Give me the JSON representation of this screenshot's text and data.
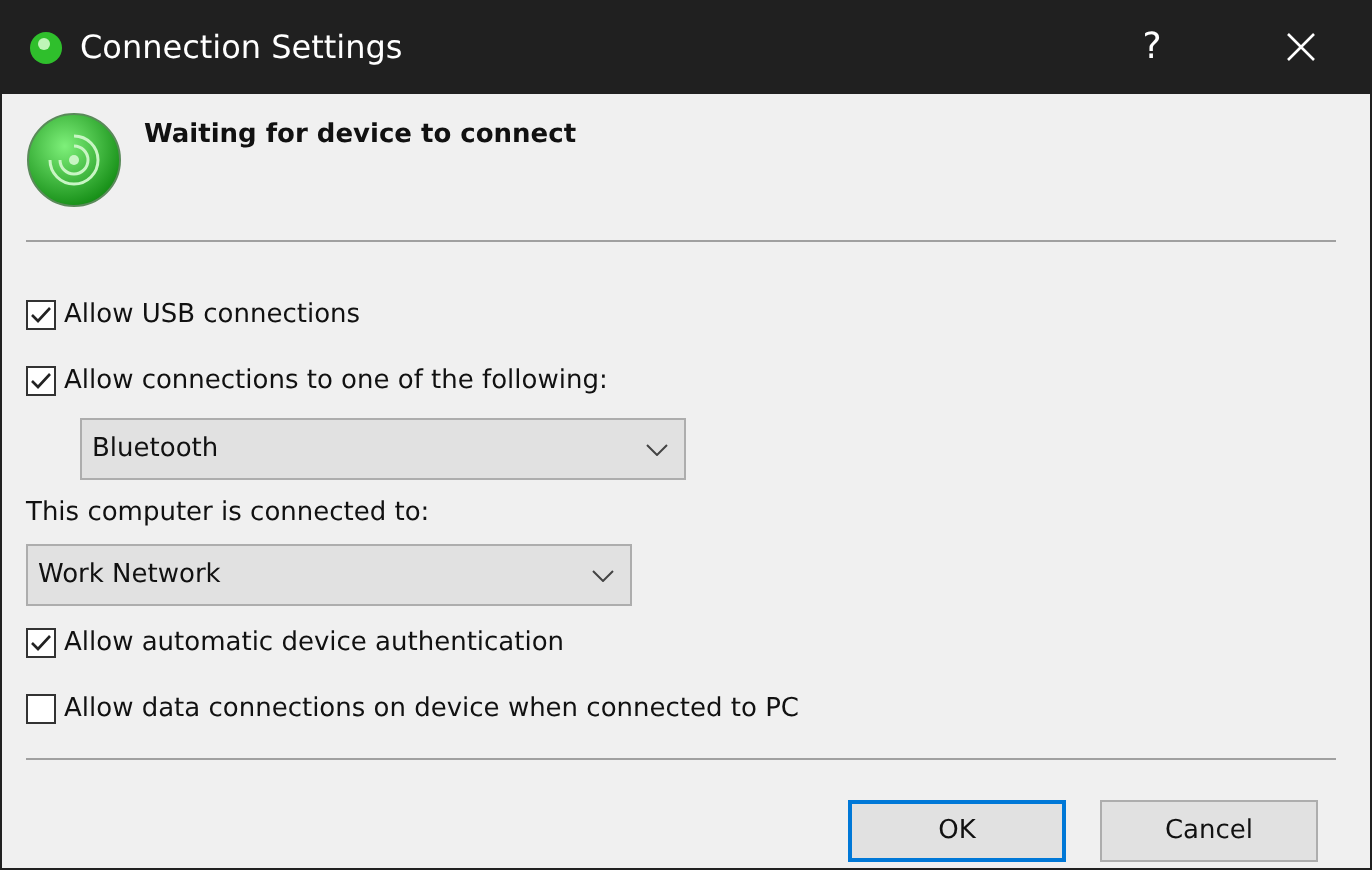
{
  "window": {
    "title": "Connection Settings",
    "help": "?"
  },
  "status": {
    "message": "Waiting for device to connect"
  },
  "controls": [
    {
      "kind": "checkbox",
      "label": "Allow USB connections",
      "checked": true
    },
    {
      "kind": "checkbox",
      "label": "Allow connections to one of the following:",
      "checked": true
    },
    {
      "kind": "select",
      "value": "Bluetooth"
    },
    {
      "kind": "label",
      "label": "This computer is connected to:"
    },
    {
      "kind": "select",
      "value": "Work Network"
    },
    {
      "kind": "checkbox",
      "label": "Allow automatic device authentication",
      "checked": true
    },
    {
      "kind": "checkbox",
      "label": "Allow data connections on device when connected to PC",
      "checked": false
    }
  ],
  "buttons": [
    {
      "label": "OK",
      "default": true
    },
    {
      "label": "Cancel",
      "default": false
    }
  ]
}
